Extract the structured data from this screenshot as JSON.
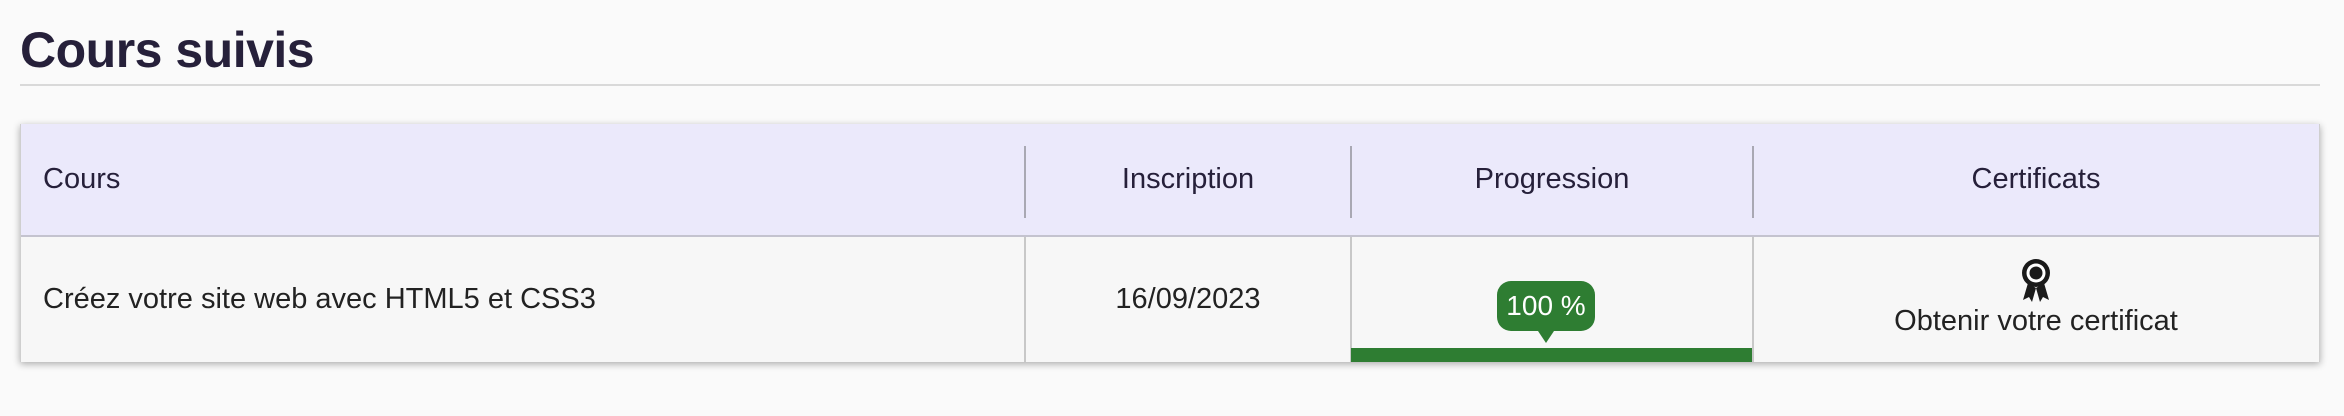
{
  "section": {
    "title": "Cours suivis"
  },
  "table": {
    "headers": {
      "course": "Cours",
      "enrollment": "Inscription",
      "progress": "Progression",
      "certificates": "Certificats"
    },
    "rows": [
      {
        "course": "Créez votre site web avec HTML5 et CSS3",
        "enrollment_date": "16/09/2023",
        "progress_label": "100 %",
        "progress_value": 100,
        "certificate_icon": "award-ribbon-icon",
        "certificate_link": "Obtenir votre certificat"
      }
    ]
  },
  "colors": {
    "header_bg": "#ebe9fb",
    "progress": "#2e7d32",
    "title": "#26203a"
  }
}
